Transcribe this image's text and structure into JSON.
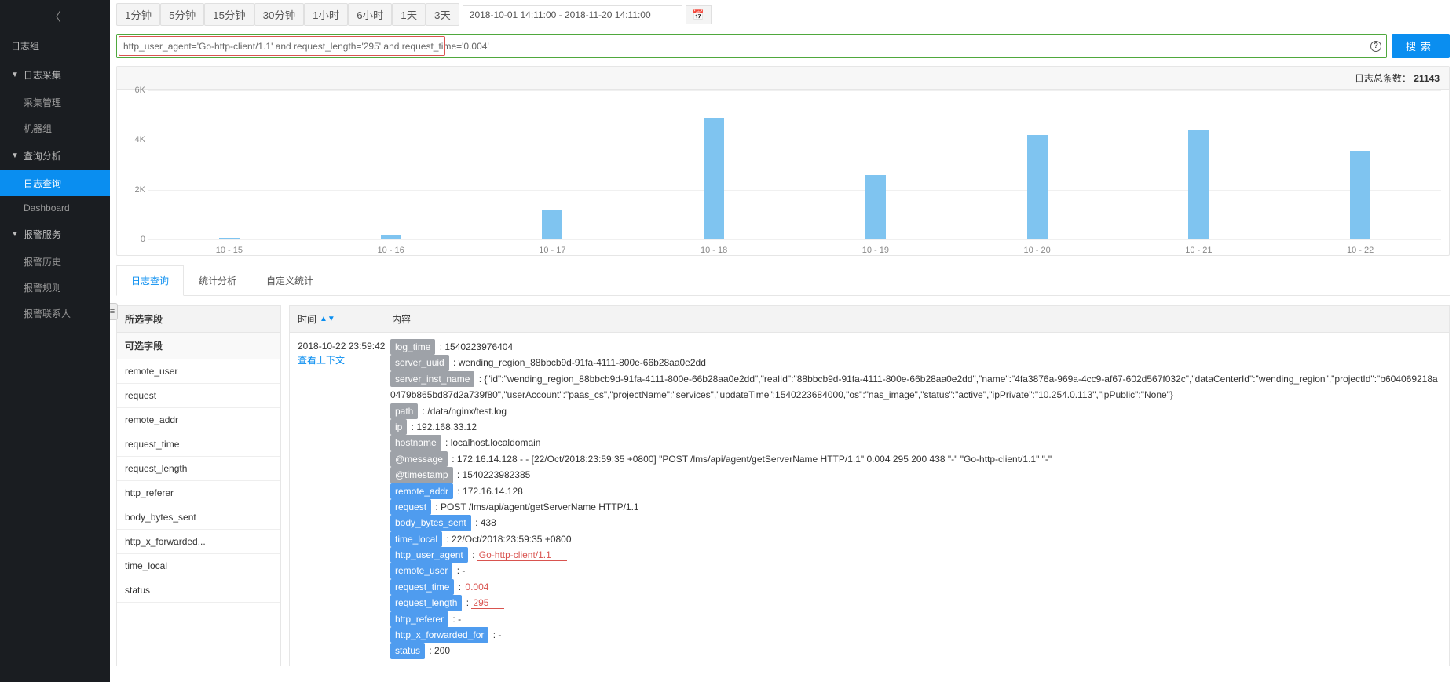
{
  "sidebar": {
    "groups": [
      {
        "label": "日志组",
        "items": []
      },
      {
        "label": "日志采集",
        "items": [
          {
            "label": "采集管理",
            "active": false
          },
          {
            "label": "机器组",
            "active": false
          }
        ]
      },
      {
        "label": "查询分析",
        "items": [
          {
            "label": "日志查询",
            "active": true
          },
          {
            "label": "Dashboard",
            "active": false
          }
        ]
      },
      {
        "label": "报警服务",
        "items": [
          {
            "label": "报警历史",
            "active": false
          },
          {
            "label": "报警规则",
            "active": false
          },
          {
            "label": "报警联系人",
            "active": false
          }
        ]
      }
    ]
  },
  "time_buttons": [
    "1分钟",
    "5分钟",
    "15分钟",
    "30分钟",
    "1小时",
    "6小时",
    "1天",
    "3天"
  ],
  "time_range": "2018-10-01 14:11:00 - 2018-11-20 14:11:00",
  "search": {
    "value": "http_user_agent='Go-http-client/1.1' and request_length='295' and request_time='0.004'",
    "button": "搜索"
  },
  "total_label": "日志总条数：",
  "total_value": "21143",
  "chart_data": {
    "type": "bar",
    "categories": [
      "10 - 15",
      "10 - 16",
      "10 - 17",
      "10 - 18",
      "10 - 19",
      "10 - 20",
      "10 - 21",
      "10 - 22"
    ],
    "values": [
      50,
      150,
      1200,
      4900,
      2600,
      4200,
      4400,
      3550
    ],
    "ylabel": "",
    "xlabel": "",
    "ylim": [
      0,
      6000
    ],
    "yticks": [
      0,
      "2K",
      "4K",
      "6K"
    ]
  },
  "tabs": [
    {
      "label": "日志查询",
      "active": true
    },
    {
      "label": "统计分析",
      "active": false
    },
    {
      "label": "自定义统计",
      "active": false
    }
  ],
  "fields": {
    "selected_header": "所选字段",
    "available_header": "可选字段",
    "available": [
      "remote_user",
      "request",
      "remote_addr",
      "request_time",
      "request_length",
      "http_referer",
      "body_bytes_sent",
      "http_x_forwarded...",
      "time_local",
      "status"
    ]
  },
  "results": {
    "col_time": "时间",
    "col_content": "内容",
    "row": {
      "time": "2018-10-22 23:59:42",
      "context_link": "查看上下文",
      "lines": [
        {
          "tag": "log_time",
          "style": "gray",
          "value": "1540223976404"
        },
        {
          "tag": "server_uuid",
          "style": "gray",
          "value": "wending_region_88bbcb9d-91fa-4111-800e-66b28aa0e2dd"
        },
        {
          "tag": "server_inst_name",
          "style": "gray",
          "value": "{\"id\":\"wending_region_88bbcb9d-91fa-4111-800e-66b28aa0e2dd\",\"realId\":\"88bbcb9d-91fa-4111-800e-66b28aa0e2dd\",\"name\":\"4fa3876a-969a-4cc9-af67-602d567f032c\",\"dataCenterId\":\"wending_region\",\"projectId\":\"b604069218a0479b865bd87d2a739f80\",\"userAccount\":\"paas_cs\",\"projectName\":\"services\",\"updateTime\":1540223684000,\"os\":\"nas_image\",\"status\":\"active\",\"ipPrivate\":\"10.254.0.113\",\"ipPublic\":\"None\"}"
        },
        {
          "tag": "path",
          "style": "gray",
          "value": "/data/nginx/test.log"
        },
        {
          "tag": "ip",
          "style": "gray",
          "value": "192.168.33.12"
        },
        {
          "tag": "hostname",
          "style": "gray",
          "value": "localhost.localdomain"
        },
        {
          "tag": "@message",
          "style": "gray",
          "value": "172.16.14.128 - - [22/Oct/2018:23:59:35 +0800] \"POST /lms/api/agent/getServerName HTTP/1.1\" 0.004 295 200 438 \"-\" \"Go-http-client/1.1\" \"-\""
        },
        {
          "tag": "@timestamp",
          "style": "gray",
          "value": "1540223982385"
        },
        {
          "tag": "remote_addr",
          "style": "blue",
          "value": "172.16.14.128"
        },
        {
          "tag": "request",
          "style": "blue",
          "value": "POST /lms/api/agent/getServerName HTTP/1.1"
        },
        {
          "tag": "body_bytes_sent",
          "style": "blue",
          "value": "438"
        },
        {
          "tag": "time_local",
          "style": "blue",
          "value": "22/Oct/2018:23:59:35 +0800"
        },
        {
          "tag": "http_user_agent",
          "style": "blue",
          "value": "Go-http-client/1.1",
          "highlight": true
        },
        {
          "tag": "remote_user",
          "style": "blue",
          "value": "-"
        },
        {
          "tag": "request_time",
          "style": "blue",
          "value": "0.004",
          "highlight": true
        },
        {
          "tag": "request_length",
          "style": "blue",
          "value": "295",
          "highlight": true
        },
        {
          "tag": "http_referer",
          "style": "blue",
          "value": "-"
        },
        {
          "tag": "http_x_forwarded_for",
          "style": "blue",
          "value": "-"
        },
        {
          "tag": "status",
          "style": "blue",
          "value": "200"
        }
      ]
    }
  }
}
